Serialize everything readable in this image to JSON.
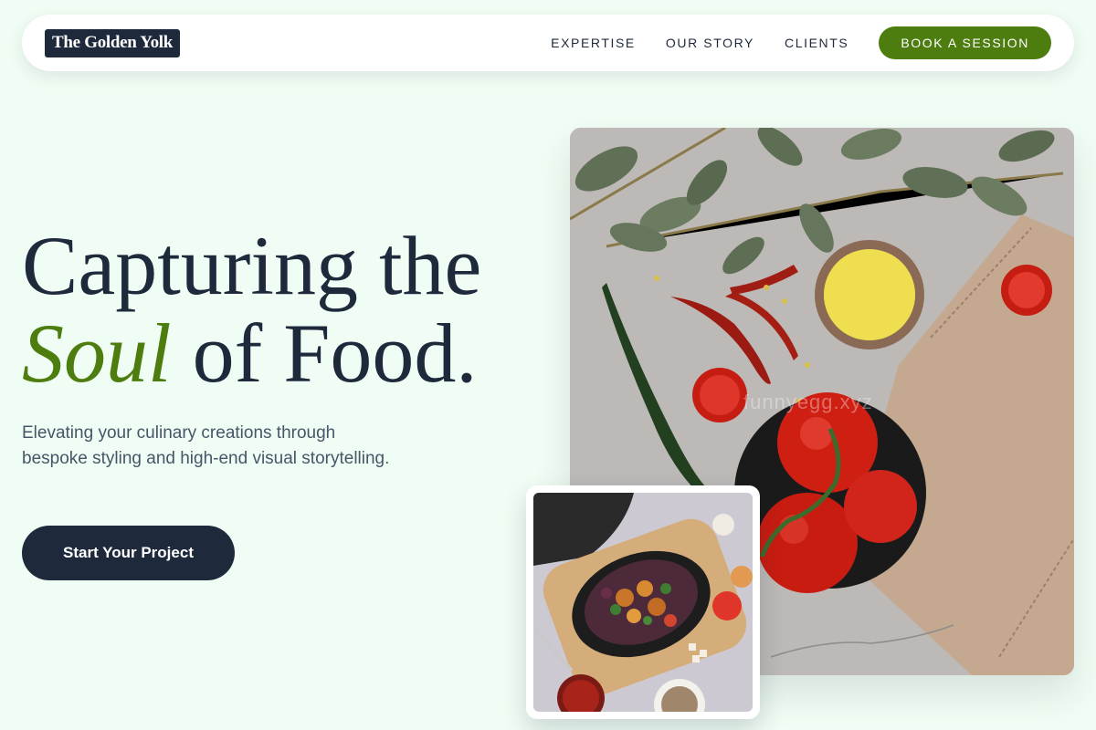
{
  "brand": {
    "logo_text": "The Golden Yolk"
  },
  "nav": {
    "links": [
      "EXPERTISE",
      "OUR STORY",
      "CLIENTS"
    ],
    "cta_label": "BOOK A SESSION"
  },
  "hero": {
    "headline_line1": "Capturing the",
    "headline_accent": "Soul",
    "headline_rest": " of Food.",
    "subtitle": "Elevating your culinary creations through bespoke styling and high-end visual storytelling.",
    "cta_label": "Start Your Project"
  },
  "images": {
    "main_watermark": "funnyegg.xyz"
  },
  "colors": {
    "background": "#f0fdf4",
    "primary_dark": "#1e293b",
    "accent_green": "#4d7c0f",
    "text_muted": "#475569"
  }
}
